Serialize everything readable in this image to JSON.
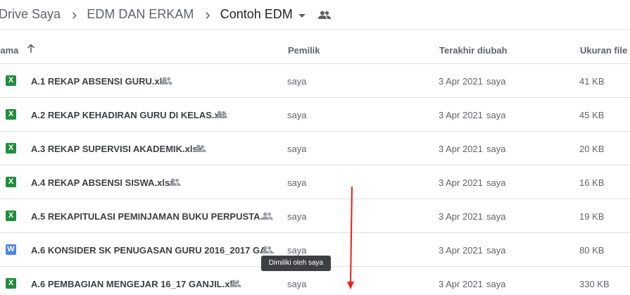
{
  "breadcrumb": {
    "items": [
      "Drive Saya",
      "EDM DAN ERKAM",
      "Contoh EDM"
    ]
  },
  "columns": {
    "name": "Nama",
    "owner": "Pemilik",
    "modified": "Terakhir diubah",
    "size": "Ukuran file"
  },
  "files": [
    {
      "name": "A.1 REKAP ABSENSI GURU.xls",
      "type": "X",
      "color": "#1e8e3e",
      "owner": "saya",
      "date": "3 Apr 2021",
      "by": "saya",
      "size": "41 KB"
    },
    {
      "name": "A.2 REKAP KEHADIRAN GURU DI KELAS.xls",
      "type": "X",
      "color": "#1e8e3e",
      "owner": "saya",
      "date": "3 Apr 2021",
      "by": "saya",
      "size": "45 KB"
    },
    {
      "name": "A.3 REKAP SUPERVISI AKADEMIK.xlsx",
      "type": "X",
      "color": "#1e8e3e",
      "owner": "saya",
      "date": "3 Apr 2021",
      "by": "saya",
      "size": "20 KB"
    },
    {
      "name": "A.4 REKAP ABSENSI SISWA.xlsx",
      "type": "X",
      "color": "#1e8e3e",
      "owner": "saya",
      "date": "3 Apr 2021",
      "by": "saya",
      "size": "16 KB"
    },
    {
      "name": "A.5 REKAPITULASI PEMINJAMAN BUKU PERPUSTA...",
      "type": "X",
      "color": "#1e8e3e",
      "owner": "saya",
      "date": "3 Apr 2021",
      "by": "saya",
      "size": "19 KB"
    },
    {
      "name": "A.6 KONSIDER SK PENUGASAN GURU 2016_2017 GA...",
      "type": "W",
      "color": "#4a86e8",
      "owner": "saya",
      "date": "3 Apr 2021",
      "by": "saya",
      "size": "80 KB"
    },
    {
      "name": "A.6 PEMBAGIAN MENGEJAR 16_17 GANJIL.xls",
      "type": "X",
      "color": "#1e8e3e",
      "owner": "saya",
      "date": "3 Apr 2021",
      "by": "saya",
      "size": "330 KB"
    }
  ],
  "tooltip": "Dimiliki oleh saya",
  "annotation_color": "#e8201a"
}
